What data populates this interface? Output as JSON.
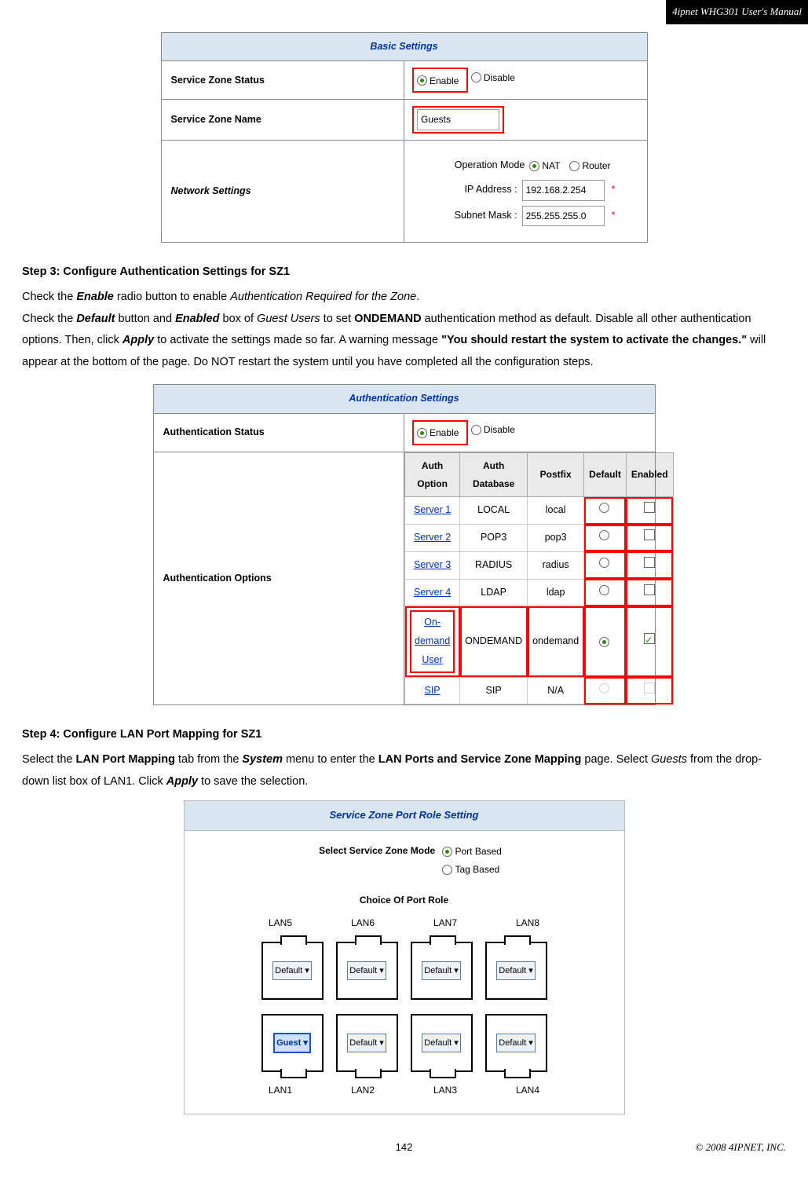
{
  "header": {
    "title": "4ipnet WHG301 User's Manual"
  },
  "footer": {
    "page": "142",
    "copyright": "© 2008 4IPNET, INC."
  },
  "fig1": {
    "section_title": "Basic Settings",
    "rows": {
      "status": {
        "label": "Service Zone Status",
        "enable": "Enable",
        "disable": "Disable"
      },
      "name": {
        "label": "Service Zone Name",
        "value": "Guests"
      },
      "net": {
        "label": "Network Settings",
        "opmode": {
          "label": "Operation Mode",
          "nat": "NAT",
          "router": "Router"
        },
        "ip": {
          "label": "IP Address :",
          "value": "192.168.2.254"
        },
        "mask": {
          "label": "Subnet Mask :",
          "value": "255.255.255.0"
        }
      }
    }
  },
  "step3": {
    "heading": "Step 3: Configure Authentication Settings for SZ1",
    "l1a": "Check the ",
    "l1b": "Enable",
    "l1c": " radio button to enable ",
    "l1d": "Authentication Required for the Zone",
    "l1e": ".",
    "l2a": "Check the ",
    "l2b": "Default",
    "l2c": " button and ",
    "l2d": "Enabled",
    "l2e": " box of ",
    "l2f": "Guest Users",
    "l2g": " to set ",
    "l2h": "ONDEMAND",
    "l2i": " authentication method as default. Disable all other authentication options. Then, click ",
    "l2j": "Apply",
    "l2k": " to activate the settings made so far. A warning message ",
    "l3a": "\"You should restart the system to activate the changes.\"",
    "l3b": " will appear at the bottom of the page. Do NOT restart the system until you have completed all the configuration steps."
  },
  "fig2": {
    "section_title": "Authentication Settings",
    "status": {
      "label": "Authentication Status",
      "enable": "Enable",
      "disable": "Disable"
    },
    "opts_label": "Authentication Options",
    "headers": {
      "opt": "Auth Option",
      "db": "Auth Database",
      "pf": "Postfix",
      "def": "Default",
      "en": "Enabled"
    },
    "rows": [
      {
        "opt": "Server 1",
        "db": "LOCAL",
        "pf": "local",
        "def": false,
        "en": false,
        "hot": false
      },
      {
        "opt": "Server 2",
        "db": "POP3",
        "pf": "pop3",
        "def": false,
        "en": false,
        "hot": false
      },
      {
        "opt": "Server 3",
        "db": "RADIUS",
        "pf": "radius",
        "def": false,
        "en": false,
        "hot": false
      },
      {
        "opt": "Server 4",
        "db": "LDAP",
        "pf": "ldap",
        "def": false,
        "en": false,
        "hot": false
      },
      {
        "opt": "On-demand User",
        "db": "ONDEMAND",
        "pf": "ondemand",
        "def": true,
        "en": true,
        "hot": true
      },
      {
        "opt": "SIP",
        "db": "SIP",
        "pf": "N/A",
        "def": null,
        "en": null,
        "hot": false
      }
    ]
  },
  "step4": {
    "heading": "Step 4: Configure LAN Port Mapping for SZ1",
    "t1": "Select the ",
    "t2": "LAN Port Mapping",
    "t3": " tab from the ",
    "t4": "System",
    "t5": " menu to enter the ",
    "t6": "LAN Ports and Service Zone Mapping",
    "t7": " page. Select ",
    "t8": "Guests",
    "t9": " from the drop-down list box of LAN1. Click ",
    "t10": "Apply",
    "t11": " to save the selection."
  },
  "fig3": {
    "section_title": "Service Zone Port Role Setting",
    "mode": {
      "label": "Select Service Zone Mode",
      "a": "Port Based",
      "b": "Tag Based"
    },
    "choice": "Choice Of Port Role",
    "top": [
      "LAN5",
      "LAN6",
      "LAN7",
      "LAN8"
    ],
    "bot": [
      "LAN1",
      "LAN2",
      "LAN3",
      "LAN4"
    ],
    "sel_default": "Default",
    "sel_guest": "Guest",
    "arrow": "▾"
  }
}
